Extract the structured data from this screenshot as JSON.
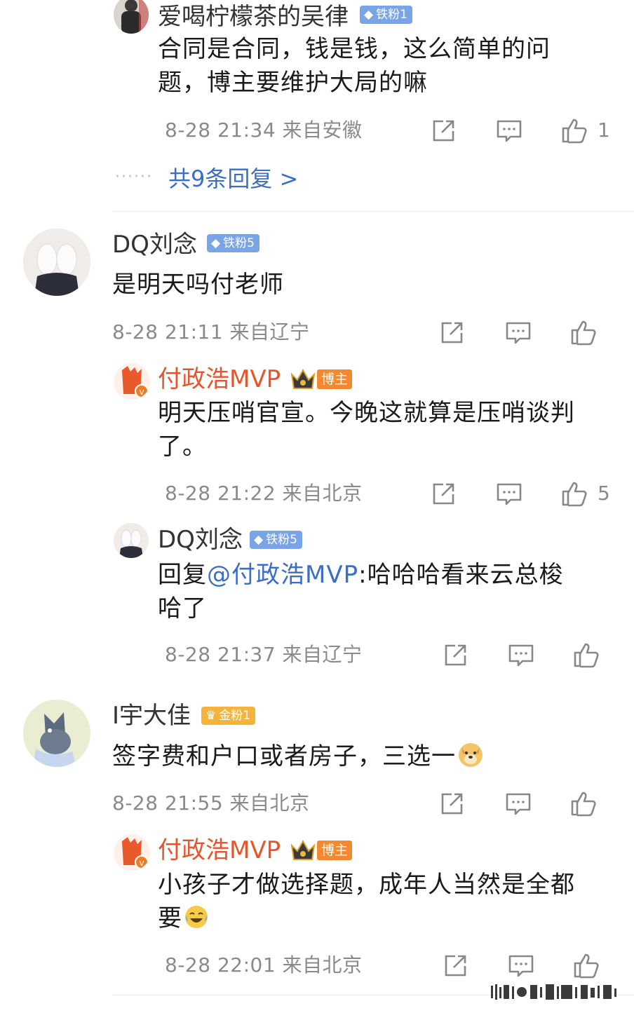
{
  "comments": [
    {
      "name": "爱喝柠檬茶的吴律",
      "badge": "铁粉1",
      "text": "合同是合同，钱是钱，这么简单的问题，博主要维护大局的嘛",
      "meta": "8-28 21:34 来自安徽",
      "likes": "1",
      "more": "共9条回复 >"
    },
    {
      "name": "DQ刘念",
      "badge": "铁粉5",
      "text": "是明天吗付老师",
      "meta": "8-28 21:11 来自辽宁"
    },
    {
      "name": "付政浩MVP",
      "badge": "博主",
      "text": "明天压哨官宣。今晚这就算是压哨谈判了。",
      "meta": "8-28 21:22 来自北京",
      "likes": "5"
    },
    {
      "name": "DQ刘念",
      "badge": "铁粉5",
      "text_prefix": "回复",
      "mention": "@付政浩MVP",
      "text": ":哈哈哈看来云总梭哈了",
      "meta": "8-28 21:37 来自辽宁"
    },
    {
      "name": "I宇大佳",
      "badge": "金粉1",
      "text": "签字费和户口或者房子，三选一",
      "meta": "8-28 21:55 来自北京"
    },
    {
      "name": "付政浩MVP",
      "badge": "博主",
      "text": "小孩子才做选择题，成年人当然是全都要",
      "meta": "8-28 22:01 来自北京"
    }
  ],
  "icons": {
    "share": "share-icon",
    "comment": "comment-icon",
    "like": "thumb-up-icon",
    "doge": "doge-emoji",
    "laugh": "laugh-cry-emoji"
  },
  "colors": {
    "accent_link": "#3a6fc4",
    "blogger_name": "#e8552c",
    "iron_badge": "#7aa4e8",
    "gold_badge": "#f2b43c",
    "host_badge": "#f2892f"
  }
}
